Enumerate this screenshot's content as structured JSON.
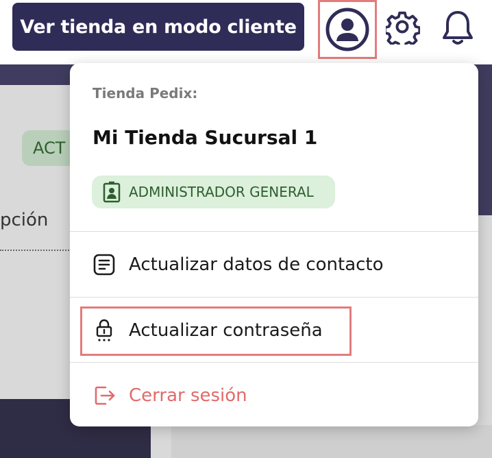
{
  "header": {
    "store_button_label": "Ver tienda en modo cliente",
    "icons": [
      "user-circle-icon",
      "gear-icon",
      "bell-icon"
    ]
  },
  "background": {
    "badge_text": "ACT",
    "partial_text": "pción"
  },
  "dropdown": {
    "store_caption": "Tienda Pedix:",
    "store_name": "Mi Tienda Sucursal 1",
    "role_badge": "ADMINISTRADOR GENERAL",
    "items": [
      {
        "label": "Actualizar datos de contacto",
        "icon": "document-icon"
      },
      {
        "label": "Actualizar contraseña",
        "icon": "lock-icon"
      },
      {
        "label": "Cerrar sesión",
        "icon": "logout-icon"
      }
    ]
  },
  "colors": {
    "brand_dark": "#2f2c57",
    "highlight": "#e27c7c",
    "logout": "#e26a6a",
    "badge_bg": "#dcf0dc",
    "badge_text": "#2e5e2e"
  }
}
